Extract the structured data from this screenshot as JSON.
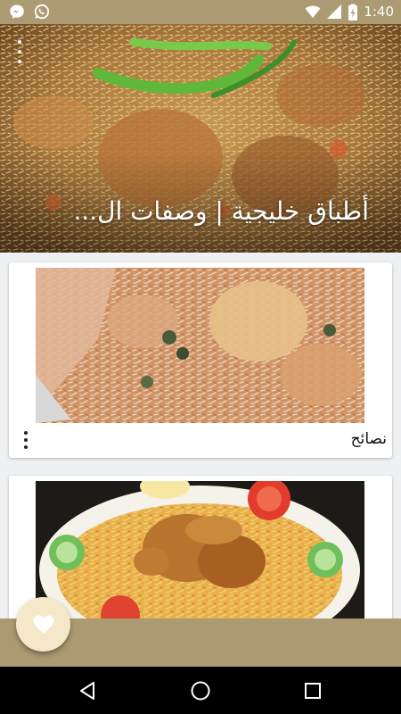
{
  "status_bar": {
    "time": "1:40",
    "icons": [
      "messenger-icon",
      "whatsapp-icon",
      "wifi-icon",
      "signal-icon",
      "battery-charging-icon"
    ]
  },
  "header": {
    "title": "أطباق خليجية | وصفات ال...",
    "image": "rice-chicken-dish-photo"
  },
  "cards": [
    {
      "title": "نصائح",
      "image": "kabsa-rice-photo"
    },
    {
      "title": "",
      "image": "roast-chicken-rice-platter-photo"
    }
  ],
  "fab": {
    "icon": "heart-icon"
  },
  "nav": {
    "buttons": [
      "back-icon",
      "home-icon",
      "recents-icon"
    ]
  },
  "colors": {
    "bar": "#ac9a72",
    "fab": "#f4e8c9",
    "nav": "#000000"
  }
}
